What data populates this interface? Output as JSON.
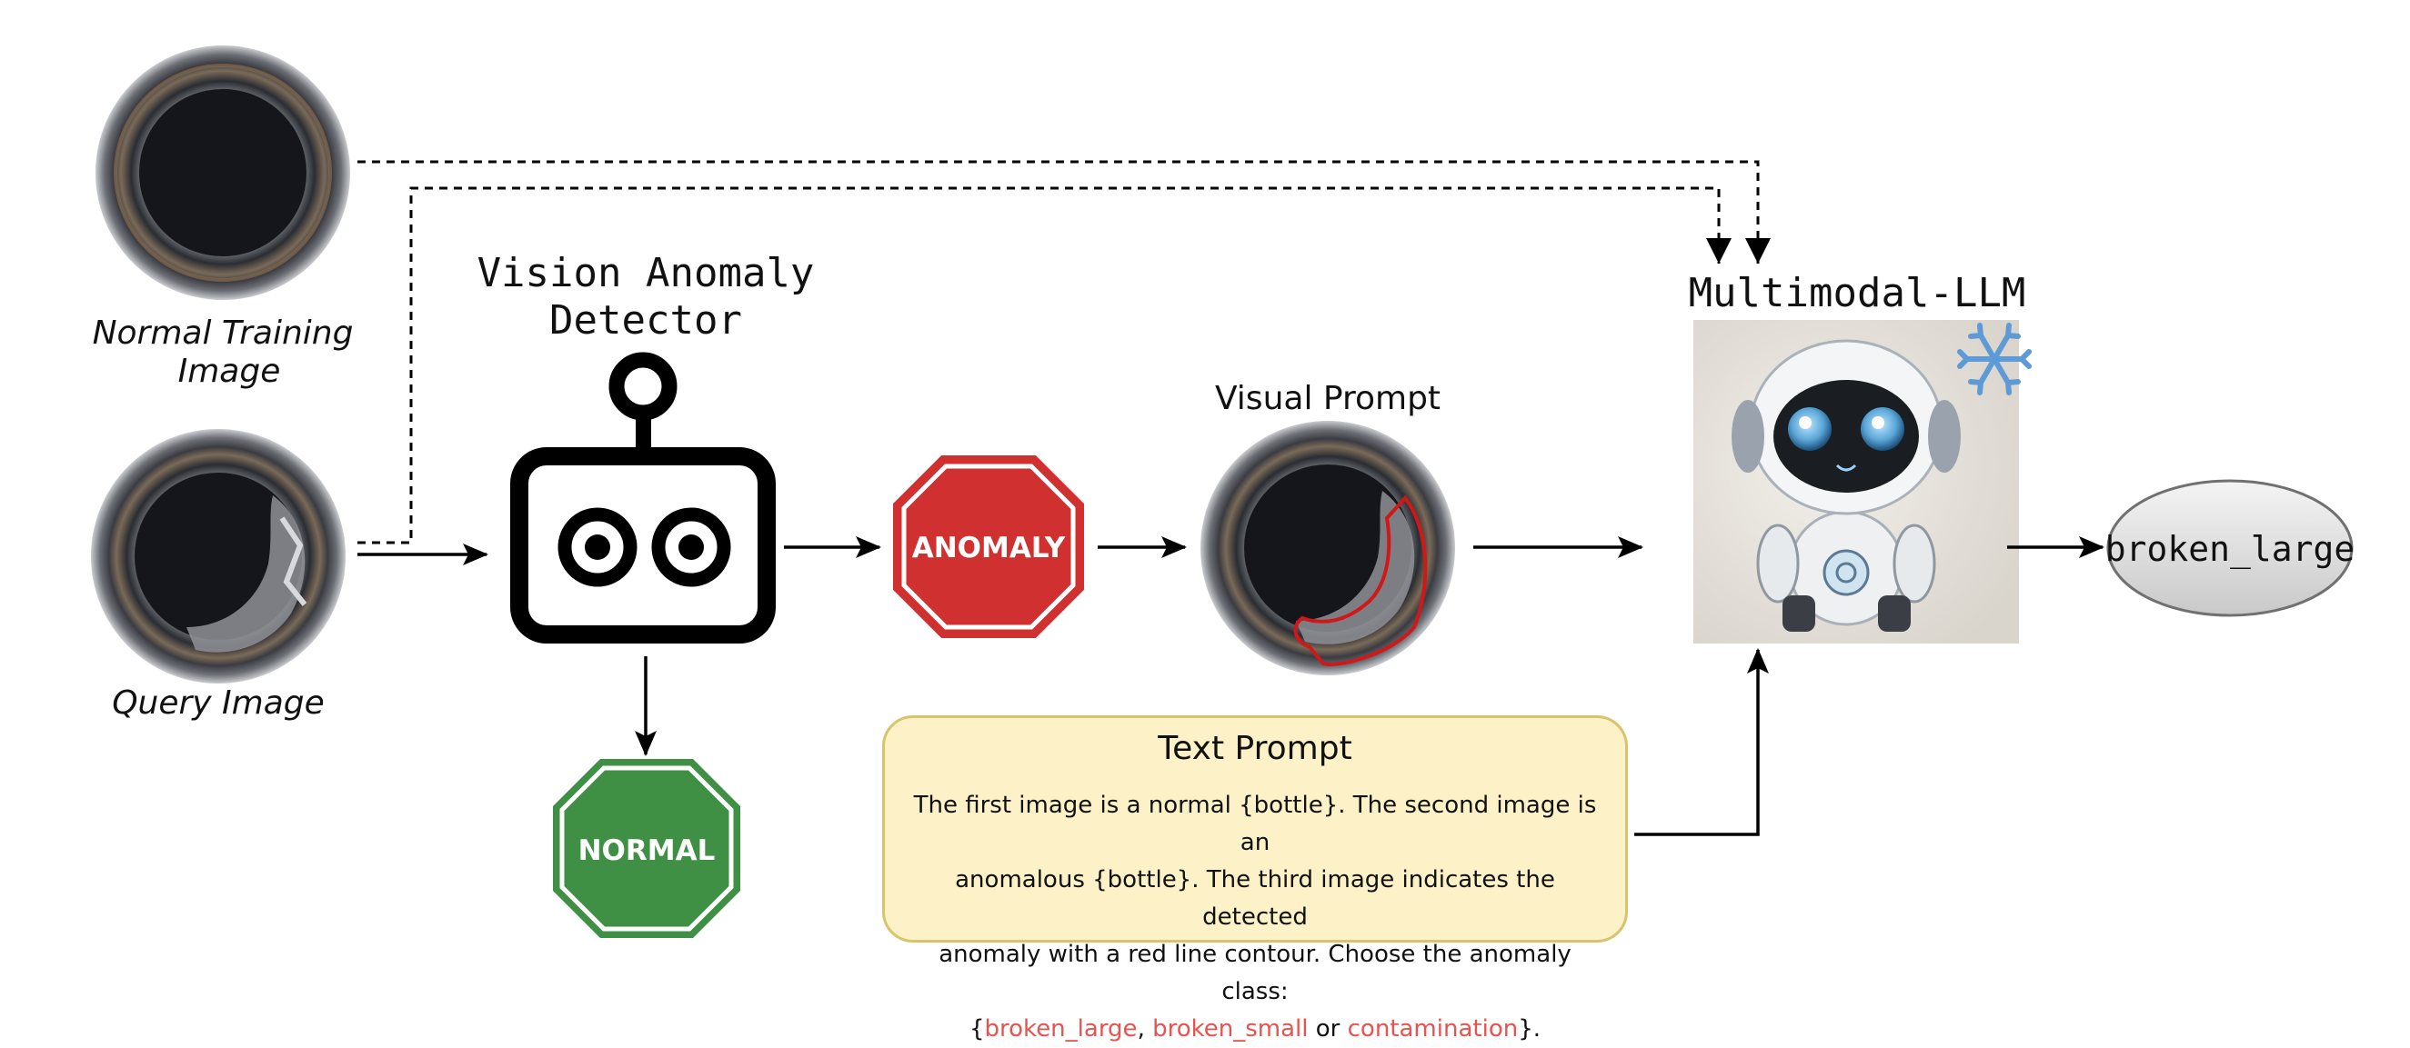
{
  "labels": {
    "normal_training_image_line1": "Normal Training",
    "normal_training_image_line2": "Image",
    "query_image": "Query Image",
    "vision_anomaly_detector_line1": "Vision Anomaly",
    "vision_anomaly_detector_line2": "Detector",
    "visual_prompt": "Visual Prompt",
    "multimodal_llm": "Multimodal-LLM",
    "output_class": "broken_large"
  },
  "signs": {
    "anomaly": "ANOMALY",
    "normal": "NORMAL"
  },
  "text_prompt": {
    "title": "Text Prompt",
    "body_line1": "The first image is a normal {bottle}. The second image is an",
    "body_line2": "anomalous {bottle}. The third image indicates the detected",
    "body_line3": "anomaly with a red line contour. Choose the anomaly class:",
    "open_brace": "{",
    "class_1": "broken_large",
    "sep_1": ", ",
    "class_2": "broken_small",
    "sep_2": " or ",
    "class_3": "contamination",
    "close": "}."
  },
  "colors": {
    "anomaly_sign": "#d03030",
    "normal_sign": "#3f8f45",
    "prompt_box_bg": "#fdf1c8",
    "prompt_box_border": "#d8c46a",
    "class_text": "#e8534f",
    "contour": "#d01818"
  },
  "icons": {
    "detector": "robot-face-icon",
    "llm": "cute-robot-icon",
    "frozen": "snowflake-icon"
  }
}
